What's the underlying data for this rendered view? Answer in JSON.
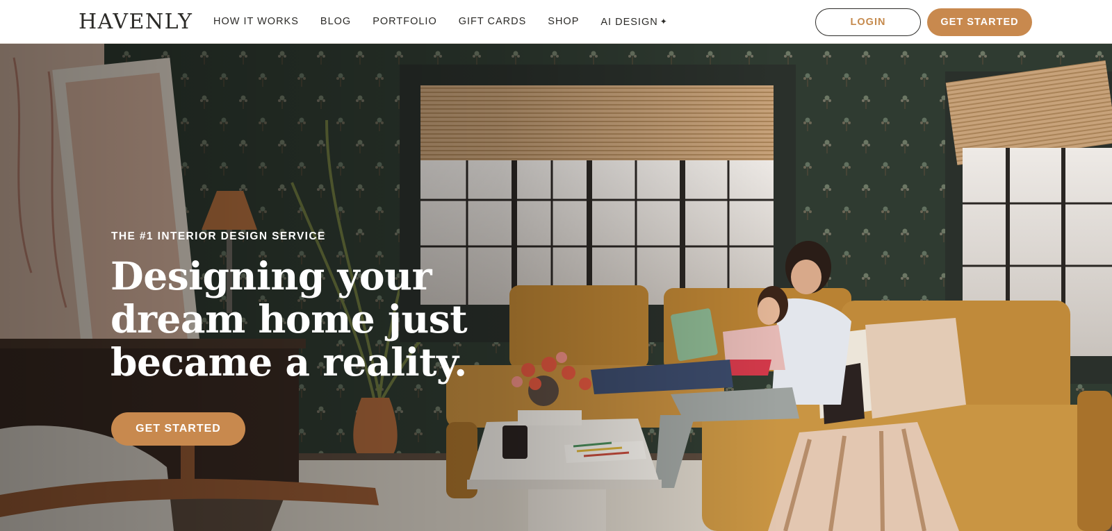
{
  "header": {
    "logo": "HAVENLY",
    "nav": [
      {
        "label": "HOW IT WORKS"
      },
      {
        "label": "BLOG"
      },
      {
        "label": "PORTFOLIO"
      },
      {
        "label": "GIFT CARDS"
      },
      {
        "label": "SHOP"
      },
      {
        "label": "AI DESIGN",
        "icon": "sparkle-icon"
      }
    ],
    "login_label": "LOGIN",
    "get_started_label": "GET STARTED"
  },
  "hero": {
    "eyebrow": "THE #1 INTERIOR DESIGN SERVICE",
    "headline": "Designing your dream home just became a reality.",
    "cta_label": "GET STARTED"
  },
  "colors": {
    "accent": "#c8894e",
    "text_dark": "#2b2a27",
    "wall_green": "#2e3a2f",
    "sofa_ochre": "#b98233"
  }
}
